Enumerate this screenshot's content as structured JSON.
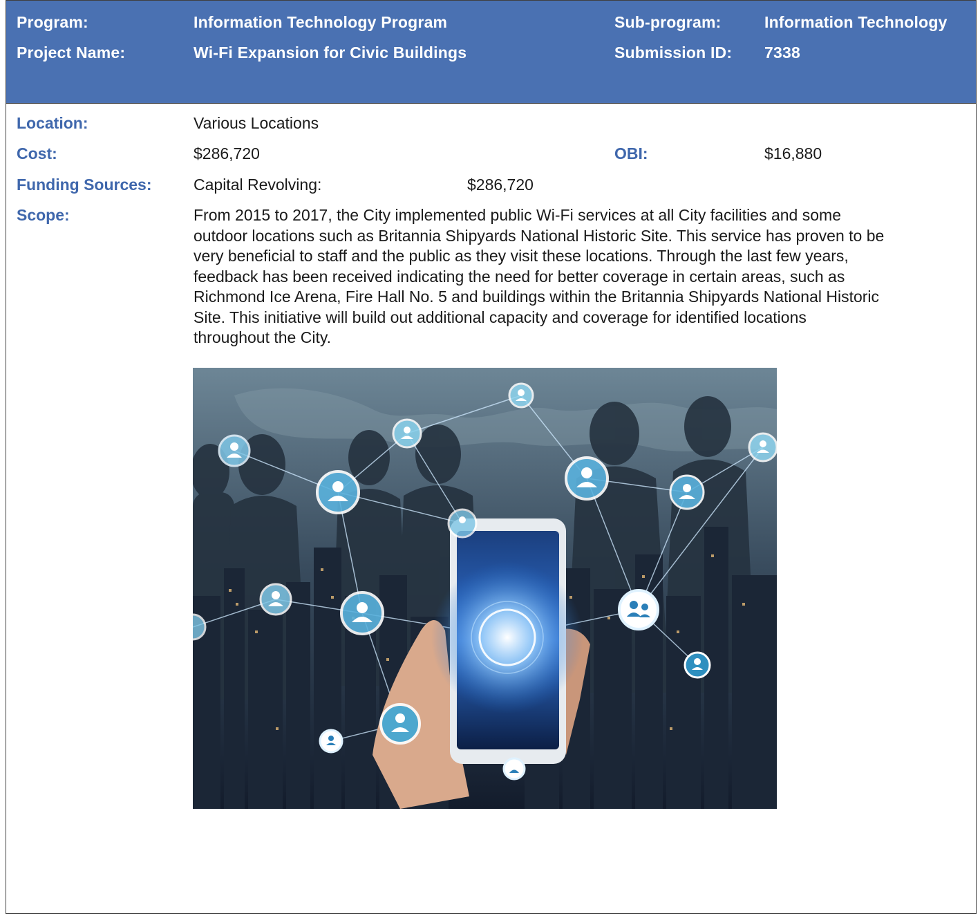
{
  "header": {
    "program_label": "Program:",
    "program_value": "Information Technology Program",
    "subprogram_label": "Sub-program:",
    "subprogram_value": "Information Technology",
    "project_label": "Project Name:",
    "project_value": "Wi-Fi Expansion for Civic Buildings",
    "submission_label": "Submission ID:",
    "submission_value": "7338"
  },
  "details": {
    "location_label": "Location:",
    "location_value": "Various Locations",
    "cost_label": "Cost:",
    "cost_value": "$286,720",
    "obi_label": "OBI:",
    "obi_value": "$16,880",
    "funding_label": "Funding Sources:",
    "funding_source": "Capital Revolving:",
    "funding_amount": "$286,720",
    "scope_label": "Scope:",
    "scope_text": "From 2015 to 2017, the City implemented public Wi-Fi services at all City facilities and some\noutdoor locations such as Britannia Shipyards National Historic Site.  This service has proven to be\nvery beneficial to staff and the public as they visit these locations.  Through the last few years,\nfeedback has been received indicating the need for better coverage in certain areas, such as\nRichmond Ice Arena, Fire Hall No. 5 and buildings within the Britannia Shipyards National Historic\nSite.  This initiative will build out additional capacity and coverage for identified locations\nthroughout the City."
  },
  "colors": {
    "header_bg": "#4a71b2",
    "label_blue": "#3f67ac"
  }
}
